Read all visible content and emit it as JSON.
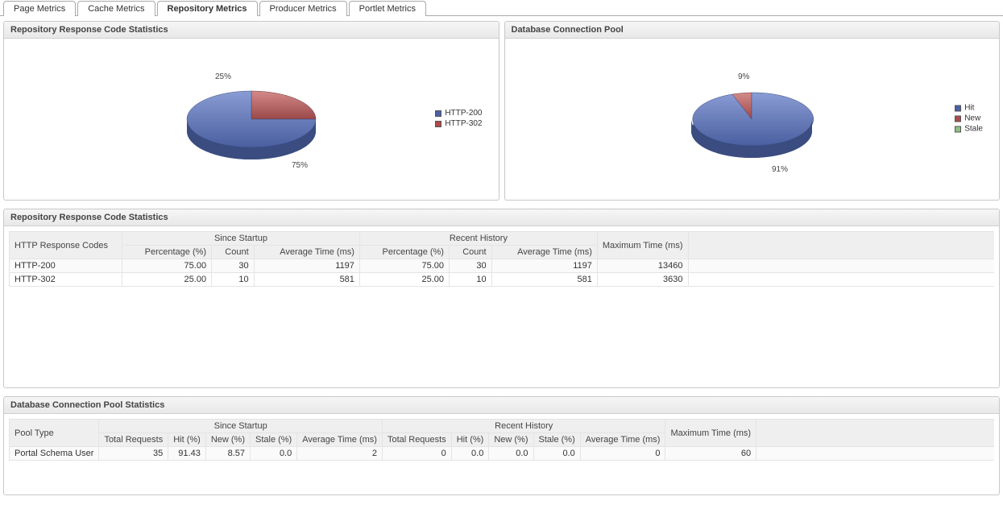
{
  "tabs": [
    {
      "label": "Page Metrics",
      "active": false
    },
    {
      "label": "Cache Metrics",
      "active": false
    },
    {
      "label": "Repository Metrics",
      "active": true
    },
    {
      "label": "Producer Metrics",
      "active": false
    },
    {
      "label": "Portlet Metrics",
      "active": false
    }
  ],
  "panel1": {
    "title": "Repository Response Code Statistics"
  },
  "panel2": {
    "title": "Database Connection Pool"
  },
  "panel3": {
    "title": "Repository Response Code Statistics"
  },
  "panel4": {
    "title": "Database Connection Pool Statistics"
  },
  "legend1": [
    {
      "label": "HTTP-200",
      "color": "blue"
    },
    {
      "label": "HTTP-302",
      "color": "red"
    }
  ],
  "legend2": [
    {
      "label": "Hit",
      "color": "blue"
    },
    {
      "label": "New",
      "color": "red"
    },
    {
      "label": "Stale",
      "color": "green"
    }
  ],
  "table1": {
    "col_root": "HTTP Response Codes",
    "group_startup": "Since Startup",
    "group_recent": "Recent History",
    "col_max": "Maximum Time (ms)",
    "col_pct": "Percentage (%)",
    "col_count": "Count",
    "col_avg": "Average Time (ms)",
    "rows": [
      {
        "name": "HTTP-200",
        "s_pct": "75.00",
        "s_count": "30",
        "s_avg": "1197",
        "r_pct": "75.00",
        "r_count": "30",
        "r_avg": "1197",
        "max": "13460"
      },
      {
        "name": "HTTP-302",
        "s_pct": "25.00",
        "s_count": "10",
        "s_avg": "581",
        "r_pct": "25.00",
        "r_count": "10",
        "r_avg": "581",
        "max": "3630"
      }
    ]
  },
  "table2": {
    "col_root": "Pool Type",
    "group_startup": "Since Startup",
    "group_recent": "Recent History",
    "col_max": "Maximum Time (ms)",
    "col_total": "Total Requests",
    "col_hit": "Hit (%)",
    "col_new": "New (%)",
    "col_stale": "Stale (%)",
    "col_avg": "Average Time (ms)",
    "rows": [
      {
        "name": "Portal Schema User",
        "s_total": "35",
        "s_hit": "91.43",
        "s_new": "8.57",
        "s_stale": "0.0",
        "s_avg": "2",
        "r_total": "0",
        "r_hit": "0.0",
        "r_new": "0.0",
        "r_stale": "0.0",
        "r_avg": "0",
        "max": "60"
      }
    ]
  },
  "chart_data": [
    {
      "type": "pie",
      "title": "Repository Response Code Statistics",
      "series": [
        {
          "name": "HTTP-200",
          "value": 75,
          "label": "75%"
        },
        {
          "name": "HTTP-302",
          "value": 25,
          "label": "25%"
        }
      ]
    },
    {
      "type": "pie",
      "title": "Database Connection Pool",
      "series": [
        {
          "name": "Hit",
          "value": 91,
          "label": "91%"
        },
        {
          "name": "New",
          "value": 9,
          "label": "9%"
        },
        {
          "name": "Stale",
          "value": 0,
          "label": ""
        }
      ]
    }
  ],
  "pieLabels": {
    "p1a": "25%",
    "p1b": "75%",
    "p2a": "9%",
    "p2b": "91%"
  }
}
